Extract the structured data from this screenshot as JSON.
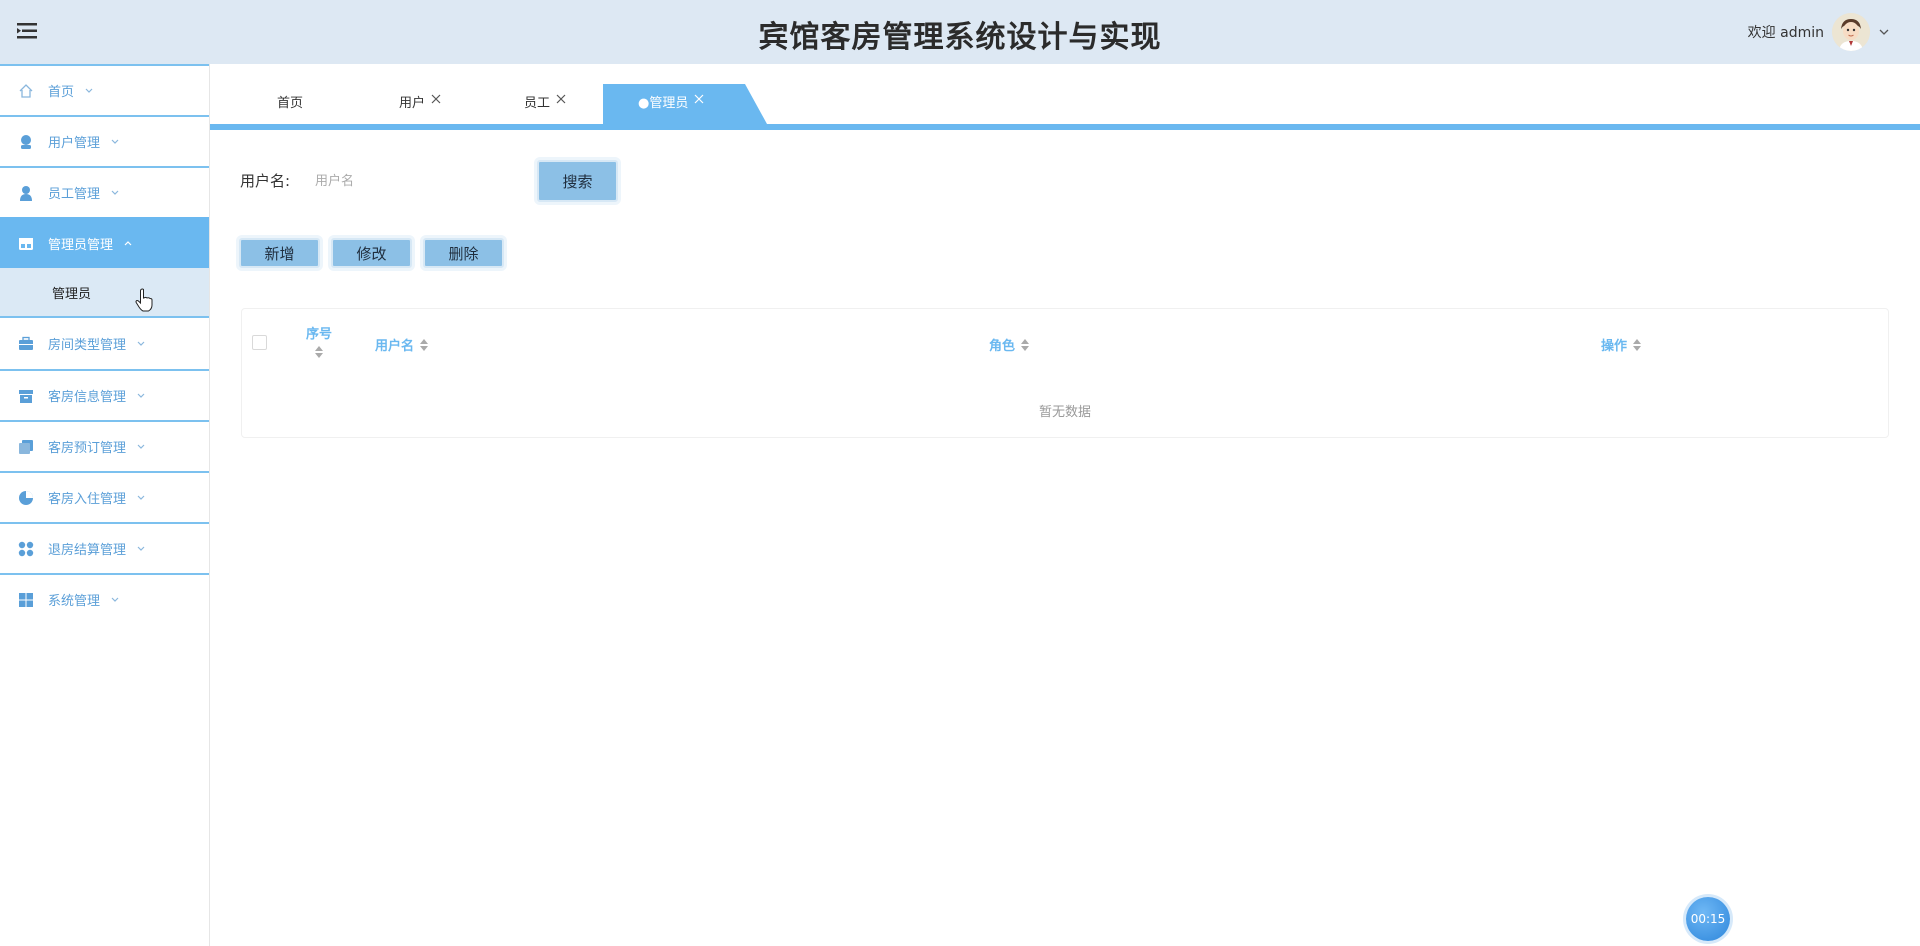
{
  "header": {
    "title": "宾馆客房管理系统设计与实现",
    "welcome": "欢迎 admin",
    "menu_icon": "menu-toggle-icon",
    "avatar_icon": "avatar"
  },
  "sidebar": {
    "items": [
      {
        "label": "首页",
        "icon": "home-icon"
      },
      {
        "label": "用户管理",
        "icon": "user-icon"
      },
      {
        "label": "员工管理",
        "icon": "person-icon"
      },
      {
        "label": "管理员管理",
        "icon": "store-icon"
      },
      {
        "label": "房间类型管理",
        "icon": "briefcase-icon"
      },
      {
        "label": "客房信息管理",
        "icon": "archive-icon"
      },
      {
        "label": "客房预订管理",
        "icon": "copy-icon"
      },
      {
        "label": "客房入住管理",
        "icon": "pie-icon"
      },
      {
        "label": "退房结算管理",
        "icon": "apps-icon"
      },
      {
        "label": "系统管理",
        "icon": "grid-icon"
      }
    ],
    "sub_item": "管理员"
  },
  "tabs": [
    {
      "label": "首页"
    },
    {
      "label": "用户"
    },
    {
      "label": "员工"
    },
    {
      "label": "●管理员"
    }
  ],
  "search": {
    "label": "用户名:",
    "placeholder": "用户名",
    "button": "搜索"
  },
  "actions": {
    "add": "新增",
    "edit": "修改",
    "delete": "删除"
  },
  "table": {
    "columns": [
      "序号",
      "用户名",
      "角色",
      "操作"
    ],
    "empty": "暂无数据"
  },
  "timer": "00:15",
  "colors": {
    "accent": "#6ab8f0",
    "header_bg": "#dde8f3",
    "button_bg": "#8cc0e6"
  }
}
